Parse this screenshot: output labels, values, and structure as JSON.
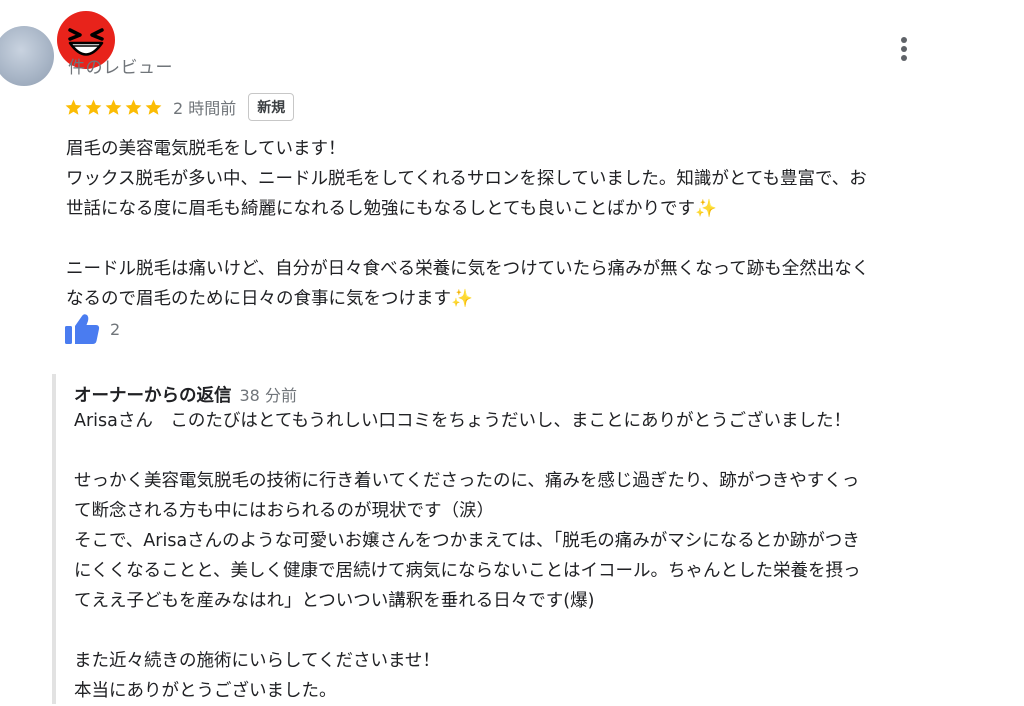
{
  "review": {
    "reviewer_subtitle": "件のレビュー",
    "rating": 5,
    "rating_max": 5,
    "time": "2 時間前",
    "new_badge": "新規",
    "text": "眉毛の美容電気脱毛をしています！\nワックス脱毛が多い中、ニードル脱毛をしてくれるサロンを探していました。知識がとても豊富で、お\n世話になる度に眉毛も綺麗になれるし勉強にもなるしとても良いことばかりです✨\n\nニードル脱毛は痛いけど、自分が日々食べる栄養に気をつけていたら痛みが無くなって跡も全然出なく\nなるので眉毛のために日々の食事に気をつけます✨",
    "helpful_count": "2"
  },
  "owner_reply": {
    "title": "オーナーからの返信",
    "time": "38 分前",
    "text": "Arisaさん　このたびはとてもうれしい口コミをちょうだいし、まことにありがとうございました！\n\nせっかく美容電気脱毛の技術に行き着いてくださったのに、痛みを感じ過ぎたり、跡がつきやすくっ\nて断念される方も中にはおられるのが現状です（涙）\nそこで、Arisaさんのような可愛いお嬢さんをつかまえては、「脱毛の痛みがマシになるとか跡がつき\nにくくなることと、美しく健康で居続けて病気にならないことはイコール。ちゃんとした栄養を摂っ\nてええ子どもを産みなはれ」とついつい講釈を垂れる日々です(爆)\n\nまた近々続きの施術にいらしてくださいませ！\n本当にありがとうございました。"
  },
  "icons": {
    "avatar": "user-avatar",
    "badge": "laughing-red-face-icon",
    "menu": "more-vert-icon",
    "star": "star-icon",
    "thumb": "thumbs-up-icon"
  },
  "colors": {
    "star": "#fbbc04",
    "thumb": "#4a7cf0",
    "emoji_red": "#e8231b",
    "muted_text": "#70757a"
  }
}
